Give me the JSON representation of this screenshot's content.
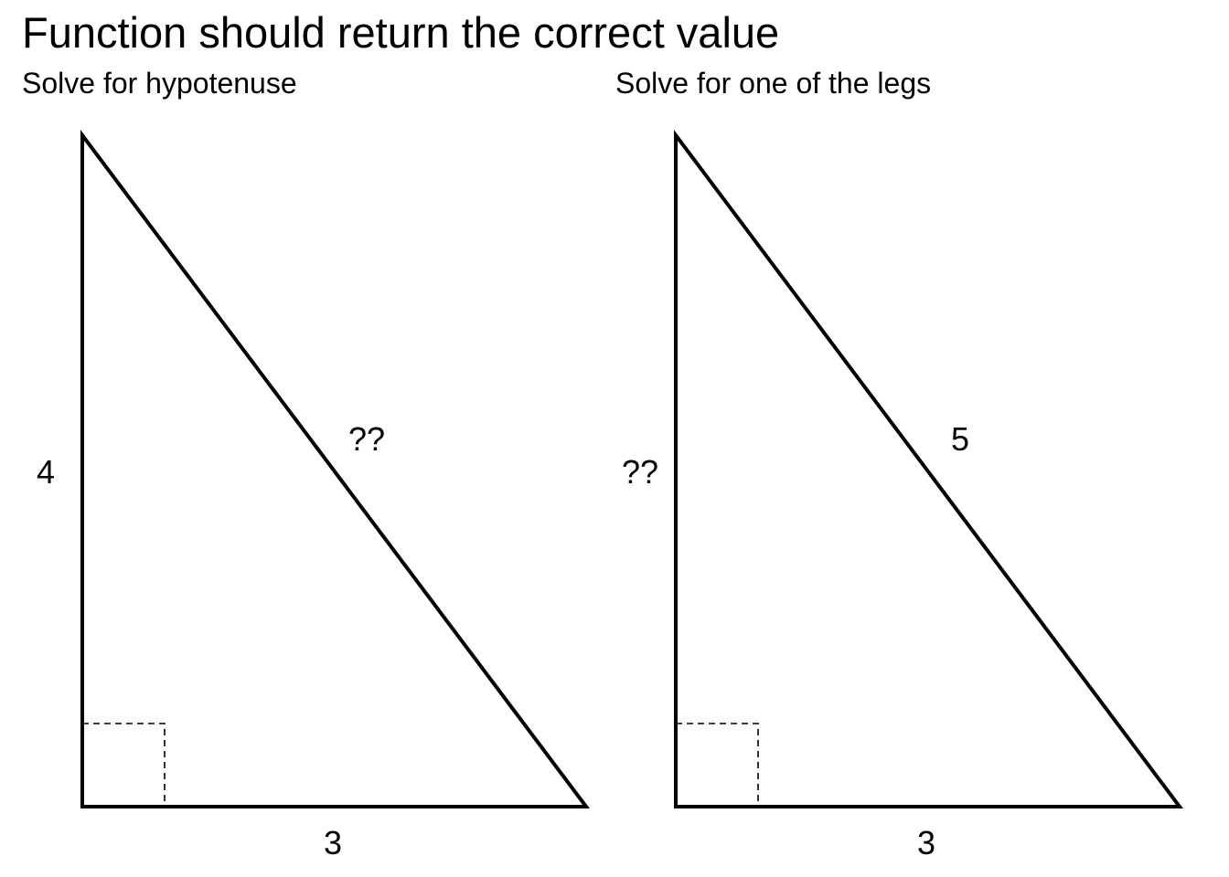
{
  "title": "Function should return the correct value",
  "panels": [
    {
      "subtitle": "Solve for hypotenuse",
      "leg_vertical_label": "4",
      "leg_horizontal_label": "3",
      "hypotenuse_label": "??"
    },
    {
      "subtitle": "Solve for one of the legs",
      "leg_vertical_label": "??",
      "leg_horizontal_label": "3",
      "hypotenuse_label": "5"
    }
  ],
  "colors": {
    "stroke": "#000000",
    "background": "#ffffff"
  }
}
